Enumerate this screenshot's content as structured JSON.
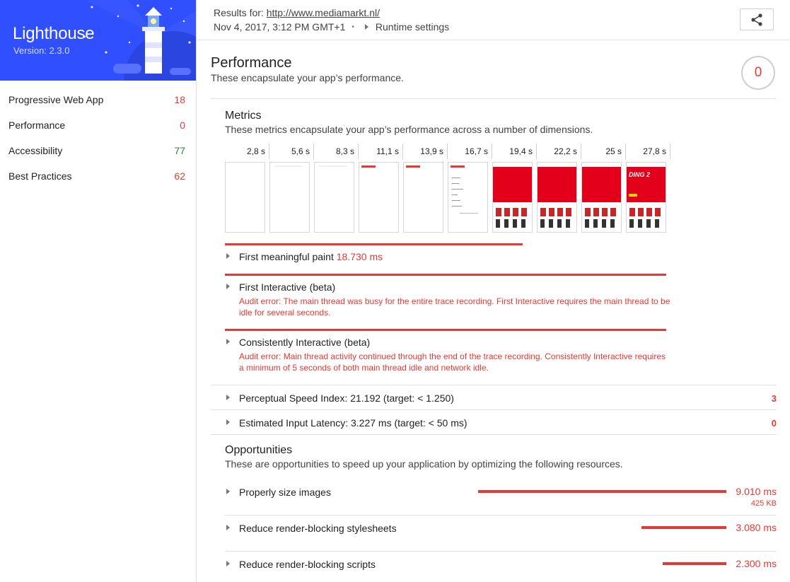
{
  "sidebar": {
    "title": "Lighthouse",
    "version": "Version: 2.3.0",
    "categories": [
      {
        "label": "Progressive Web App",
        "score": "18",
        "color": "#e53935"
      },
      {
        "label": "Performance",
        "score": "0",
        "color": "#e53935"
      },
      {
        "label": "Accessibility",
        "score": "77",
        "color": "#2e7d32"
      },
      {
        "label": "Best Practices",
        "score": "62",
        "color": "#e53935"
      }
    ]
  },
  "header": {
    "results_prefix": "Results for:",
    "url": "http://www.mediamarkt.nl/",
    "date": "Nov 4, 2017, 3:12 PM GMT+1",
    "runtime_settings": "Runtime settings",
    "share_icon": "share-icon"
  },
  "performance": {
    "title": "Performance",
    "description": "These encapsulate your app’s performance.",
    "score": "0",
    "metrics": {
      "title": "Metrics",
      "description": "These metrics encapsulate your app’s performance across a number of dimensions.",
      "filmstrip": [
        "2,8 s",
        "5,6 s",
        "8,3 s",
        "11,1 s",
        "13,9 s",
        "16,7 s",
        "19,4 s",
        "22,2 s",
        "25 s",
        "27,8 s"
      ],
      "banner_text": "DING 2",
      "items": [
        {
          "label": "First meaningful paint",
          "value": "18.730 ms",
          "bar_fraction": 0.675
        },
        {
          "label": "First Interactive (beta)",
          "error": "Audit error: The main thread was busy for the entire trace recording. First Interactive requires the main thread to be idle for several seconds.",
          "bar_fraction": 1.0
        },
        {
          "label": "Consistently Interactive (beta)",
          "error": "Audit error: Main thread activity continued through the end of the trace recording. Consistently Interactive requires a minimum of 5 seconds of both main thread idle and network idle.",
          "bar_fraction": 1.0
        }
      ],
      "perceptual_speed": {
        "label": "Perceptual Speed Index: 21.192 (target: < 1.250)",
        "score": "3"
      },
      "input_latency": {
        "label": "Estimated Input Latency: 3.227 ms (target: < 50 ms)",
        "score": "0"
      }
    },
    "opportunities": {
      "title": "Opportunities",
      "description": "These are opportunities to speed up your application by optimizing the following resources.",
      "items": [
        {
          "label": "Properly size images",
          "ms": "9.010 ms",
          "kb": "425 KB",
          "bar_fraction": 1.0
        },
        {
          "label": "Reduce render-blocking stylesheets",
          "ms": "3.080 ms",
          "bar_fraction": 0.342
        },
        {
          "label": "Reduce render-blocking scripts",
          "ms": "2.300 ms",
          "bar_fraction": 0.255
        }
      ]
    }
  },
  "colors": {
    "fail": "#e53935",
    "pass": "#2e7d32",
    "brand": "#304ffe"
  }
}
